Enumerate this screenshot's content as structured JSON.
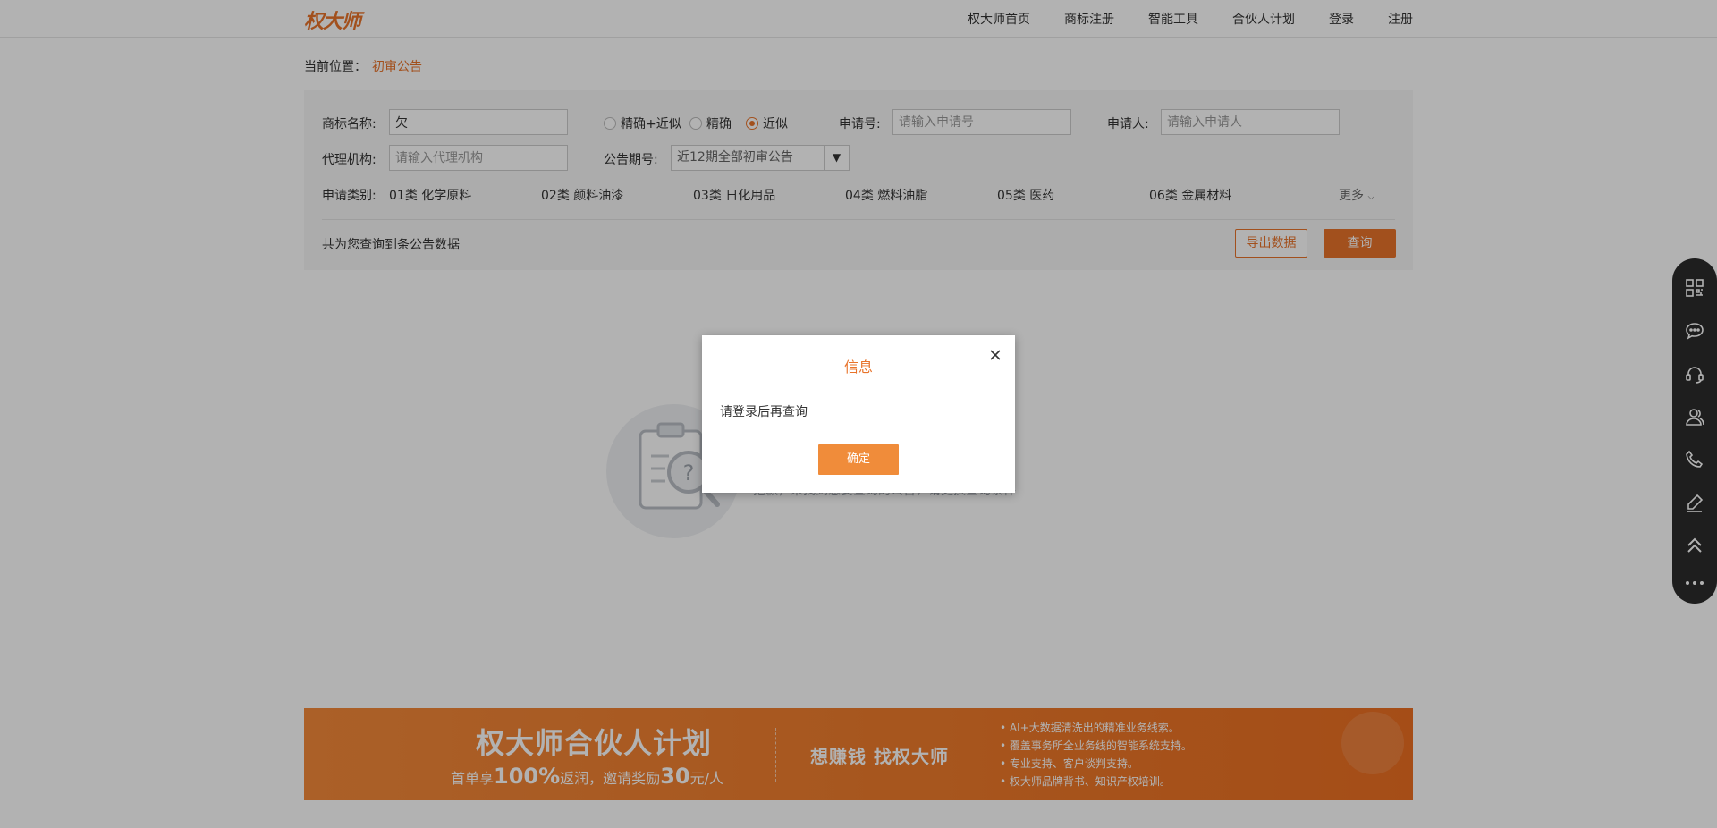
{
  "header": {
    "logo": "权大师",
    "nav": [
      "权大师首页",
      "商标注册",
      "智能工具",
      "合伙人计划",
      "登录",
      "注册"
    ]
  },
  "breadcrumb": {
    "label": "当前位置：",
    "current": "初审公告"
  },
  "search": {
    "tm_name_label": "商标名称:",
    "tm_name_value": "欠",
    "match_options": [
      "精确+近似",
      "精确",
      "近似"
    ],
    "match_selected": "近似",
    "app_no_label": "申请号:",
    "app_no_placeholder": "请输入申请号",
    "applicant_label": "申请人:",
    "applicant_placeholder": "请输入申请人",
    "agency_label": "代理机构:",
    "agency_placeholder": "请输入代理机构",
    "period_label": "公告期号:",
    "period_value": "近12期全部初审公告",
    "category_label": "申请类别:",
    "categories": [
      "01类 化学原料",
      "02类 颜料油漆",
      "03类 日化用品",
      "04类 燃料油脂",
      "05类 医药",
      "06类 金属材料"
    ],
    "more_label": "更多",
    "result_text": "共为您查询到条公告数据",
    "export_label": "导出数据",
    "query_label": "查询"
  },
  "empty": {
    "text": "抱歉，未找到您要查询的公告，请更换查询条件"
  },
  "banner": {
    "title": "权大师合伙人计划",
    "sub_prefix": "首单享",
    "sub_pct": "100%",
    "sub_mid": "返润，邀请奖励",
    "sub_amt": "30",
    "sub_suffix": "元/人",
    "slogan": "想赚钱  找权大师",
    "points": [
      "AI+大数据清洗出的精准业务线索。",
      "覆盖事务所全业务线的智能系统支持。",
      "专业支持、客户谈判支持。",
      "权大师品牌背书、知识产权培训。"
    ]
  },
  "sidebar": {
    "icons": [
      "qrcode-icon",
      "chat-icon",
      "headset-icon",
      "user-icon",
      "phone-icon",
      "edit-icon",
      "back-to-top-icon",
      "more-icon"
    ]
  },
  "dialog": {
    "title": "信息",
    "message": "请登录后再查询",
    "ok_label": "确定"
  },
  "colors": {
    "accent": "#e8732a",
    "dialog_button": "#f08c3a",
    "sidebar": "#2b2b2b"
  }
}
